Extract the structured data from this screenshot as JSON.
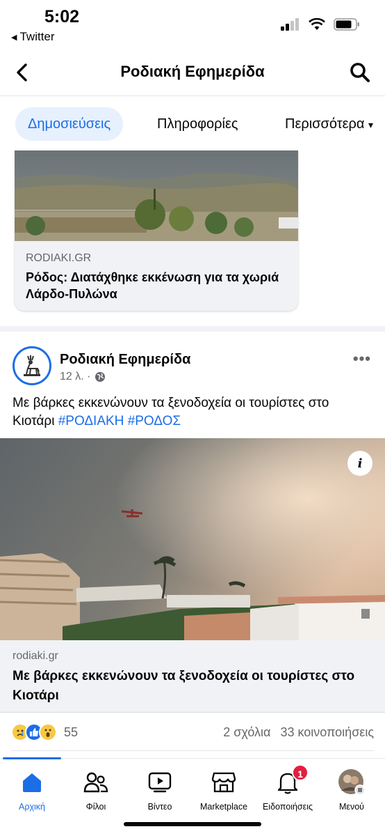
{
  "status_bar": {
    "time": "5:02",
    "back_app": "Twitter"
  },
  "header": {
    "title": "Ροδιακή Εφημερίδα"
  },
  "tabs": [
    {
      "label": "Δημοσιεύσεις",
      "active": true
    },
    {
      "label": "Πληροφορίες",
      "active": false
    },
    {
      "label": "Περισσότερα",
      "active": false
    }
  ],
  "shared_card": {
    "domain": "RODIAKI.GR",
    "headline": "Ρόδος: Διατάχθηκε εκκένωση για τα χωριά Λάρδο-Πυλώνα"
  },
  "post": {
    "page_name": "Ροδιακή Εφημερίδα",
    "time": "12 λ. ·",
    "text": "Με βάρκες εκκενώνουν τα ξενοδοχεία οι τουρίστες στο Κιοτάρι",
    "hashtags": [
      "#ΡΟΔΙΑΚΗ",
      "#ΡΟΔΟΣ"
    ],
    "link": {
      "domain": "rodiaki.gr",
      "headline": "Με βάρκες εκκενώνουν τα ξενοδοχεία οι τουρίστες στο Κιοτάρι"
    },
    "reactions": {
      "count": "55",
      "comments": "2 σχόλια",
      "shares": "33 κοινοποιήσεις"
    }
  },
  "bottom_nav": [
    {
      "label": "Αρχική",
      "icon": "home-icon",
      "active": true
    },
    {
      "label": "Φίλοι",
      "icon": "friends-icon"
    },
    {
      "label": "Βίντεο",
      "icon": "video-icon"
    },
    {
      "label": "Marketplace",
      "icon": "marketplace-icon"
    },
    {
      "label": "Ειδοποιήσεις",
      "icon": "bell-icon",
      "badge": "1"
    },
    {
      "label": "Μενού",
      "icon": "avatar-icon"
    }
  ],
  "colors": {
    "accent": "#1b6ee6",
    "badge": "#e41e3f",
    "muted": "#65676b"
  }
}
